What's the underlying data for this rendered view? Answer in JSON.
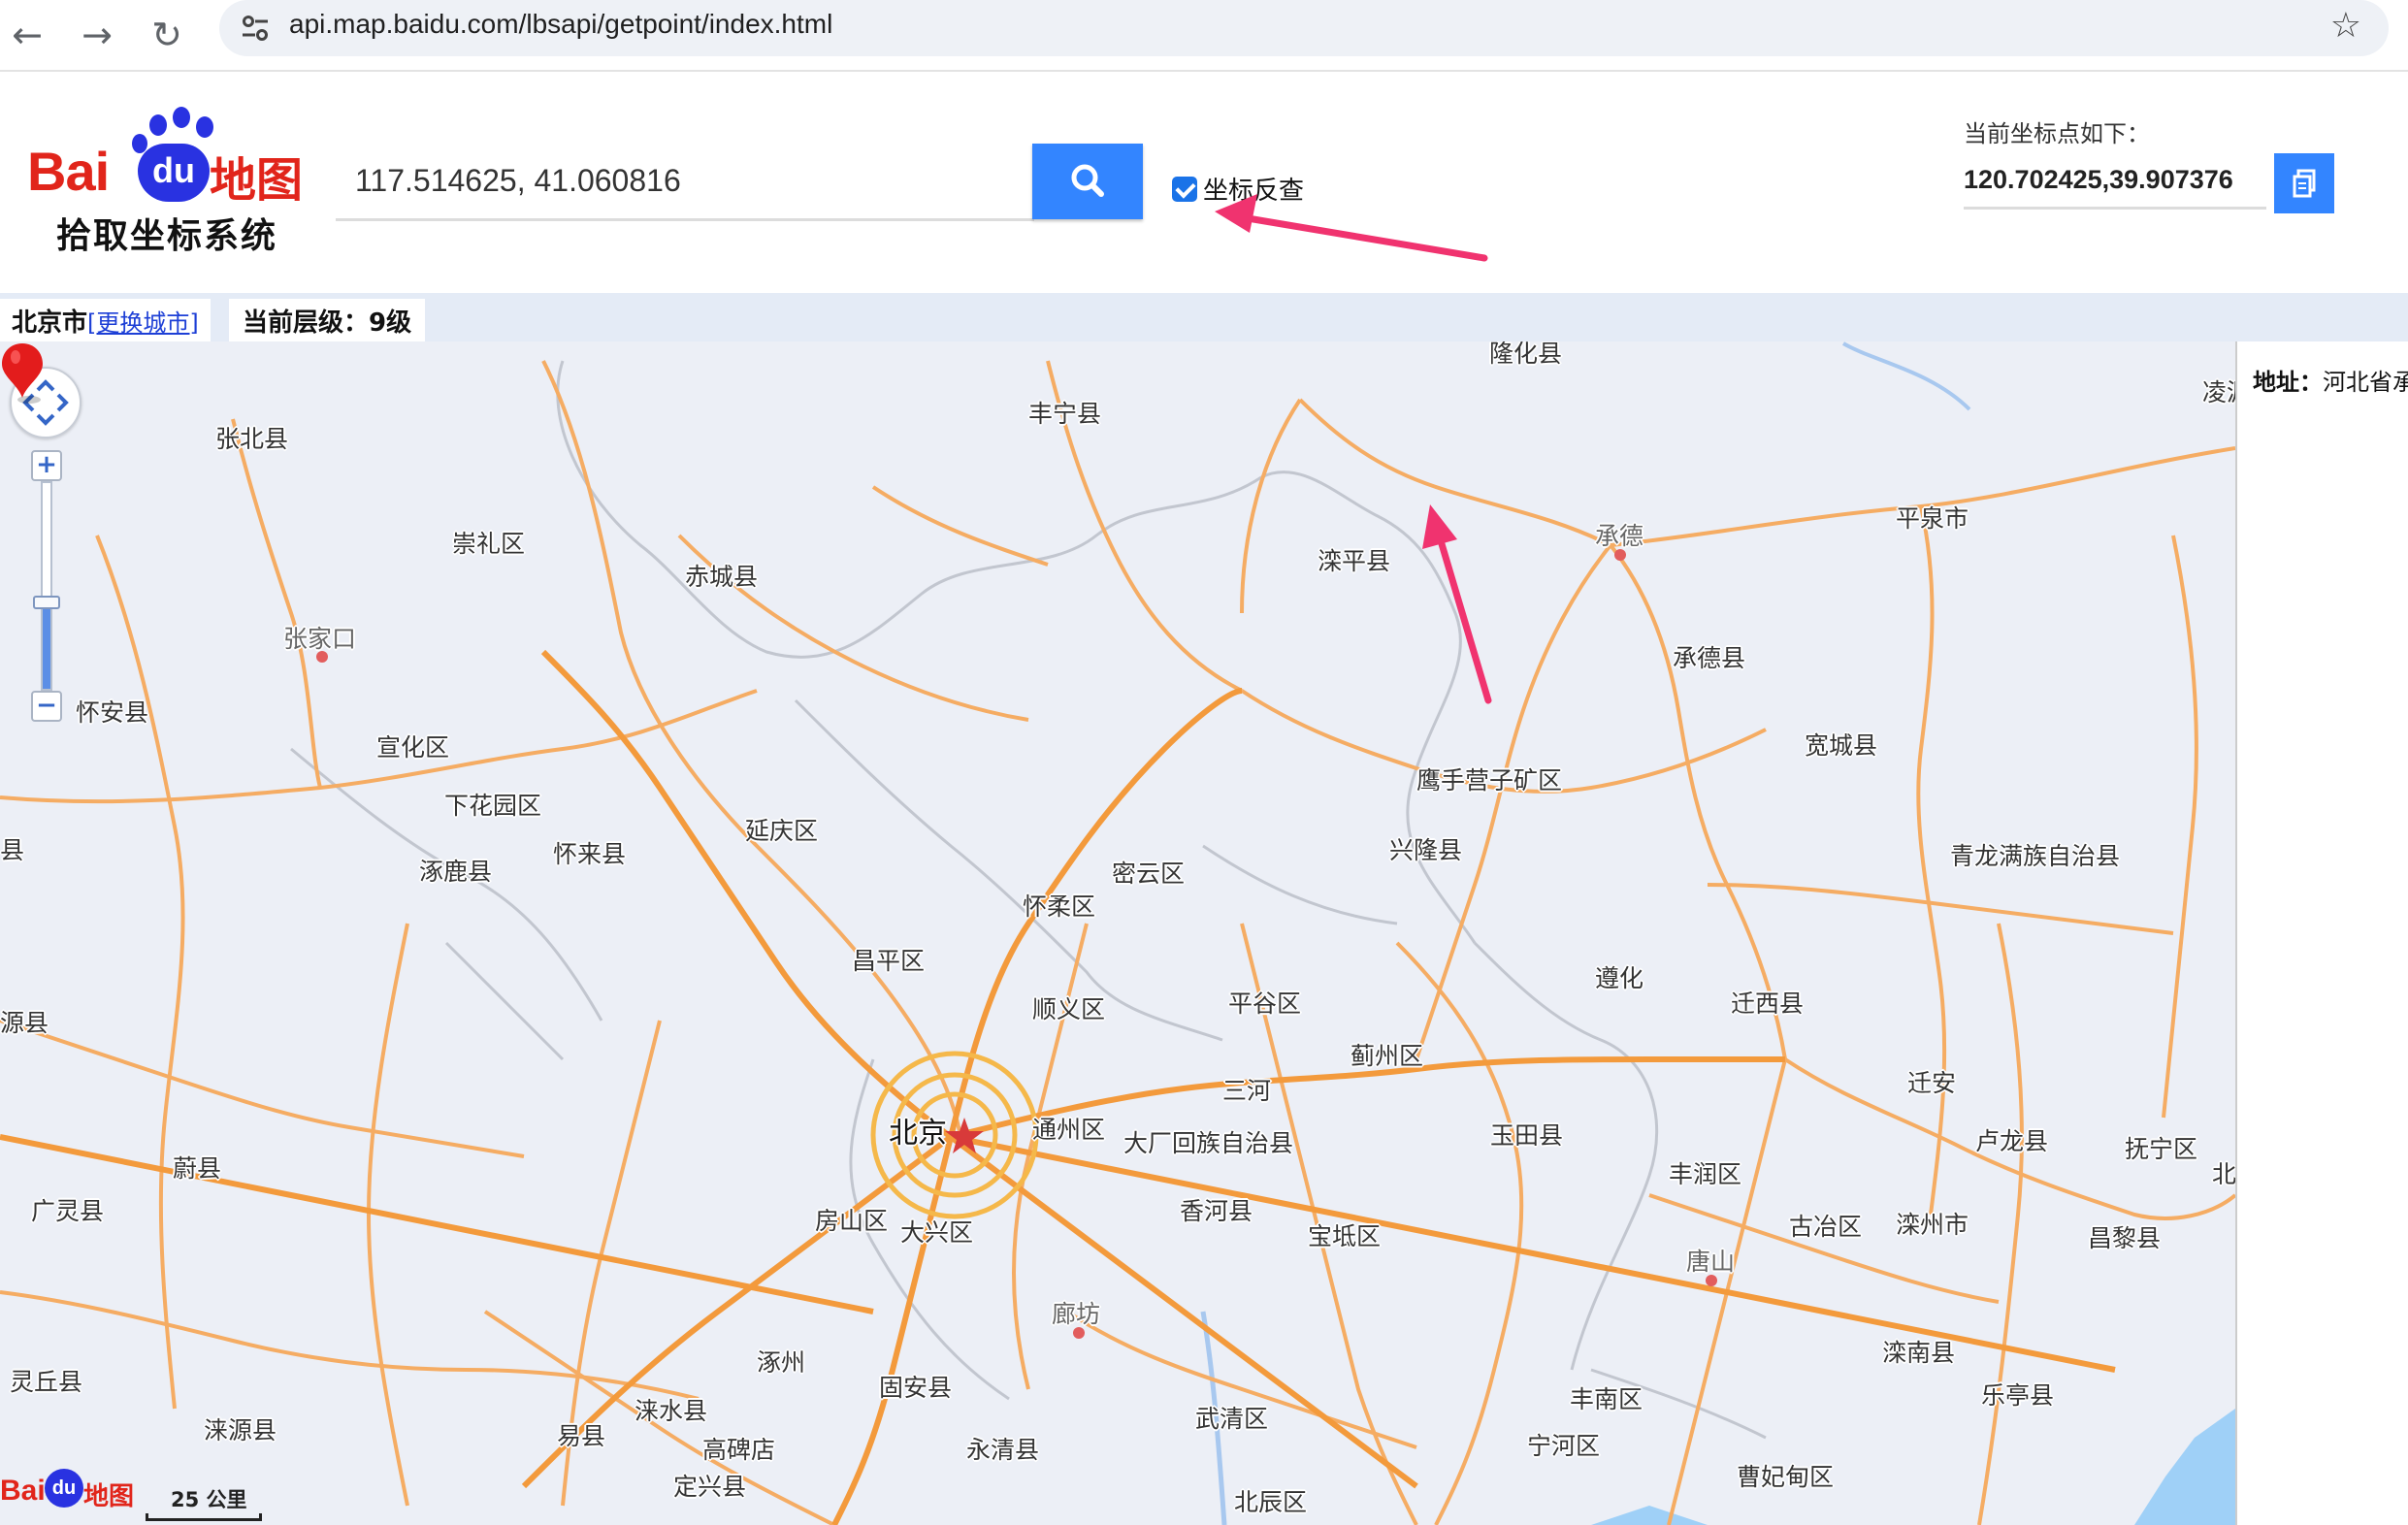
{
  "browser": {
    "url": "api.map.baidu.com/lbsapi/getpoint/index.html"
  },
  "header": {
    "logo_text": "Bai",
    "logo_du": "du",
    "logo_ditu": "地图",
    "logo_subtitle": "拾取坐标系统",
    "search_value": "117.514625, 41.060816",
    "reverse_lookup_label": "坐标反查",
    "reverse_lookup_checked": true,
    "coord_title": "当前坐标点如下：",
    "coord_value": "120.702425,39.907376"
  },
  "status": {
    "city": "北京市",
    "change_city": "[更换城市]",
    "level_label": "当前层级：",
    "level_value": "9级"
  },
  "side_panel": {
    "address_label": "地址：",
    "address_value": "河北省承"
  },
  "map": {
    "scale_label": "25 公里",
    "labels": [
      "隆化县",
      "凌源",
      "张北县",
      "丰宁县",
      "崇礼区",
      "赤城县",
      "滦平县",
      "承德",
      "平泉市",
      "张家口",
      "怀安县",
      "承德县",
      "宣化区",
      "宽城县",
      "鹰手营子矿区",
      "下花园区",
      "延庆区",
      "县",
      "涿鹿县",
      "怀来县",
      "兴隆县",
      "密云区",
      "青龙满族自治县",
      "怀柔区",
      "昌平区",
      "遵化",
      "迁西县",
      "源县",
      "顺义区",
      "平谷区",
      "蓟州区",
      "三河",
      "迁安",
      "北京",
      "通州区",
      "大厂回族自治县",
      "玉田县",
      "卢龙县",
      "抚宁区",
      "蔚县",
      "丰润区",
      "北",
      "广灵县",
      "房山区",
      "大兴区",
      "香河县",
      "宝坻区",
      "古冶区",
      "滦州市",
      "昌黎县",
      "唐山",
      "廊坊",
      "涿州",
      "滦南县",
      "灵丘县",
      "固安县",
      "乐亭县",
      "涞源县",
      "涞水县",
      "易县",
      "武清区",
      "丰南区",
      "高碑店",
      "永清县",
      "宁河区",
      "定兴县",
      "北辰区",
      "曹妃甸区"
    ]
  },
  "colors": {
    "accent": "#3385ff",
    "map_bg": "#eceff6",
    "road": "#f5a95c",
    "road_major": "#f39a3c",
    "border": "#c4c8d0",
    "pin": "#e31c1c",
    "arrow": "#f0336f"
  }
}
